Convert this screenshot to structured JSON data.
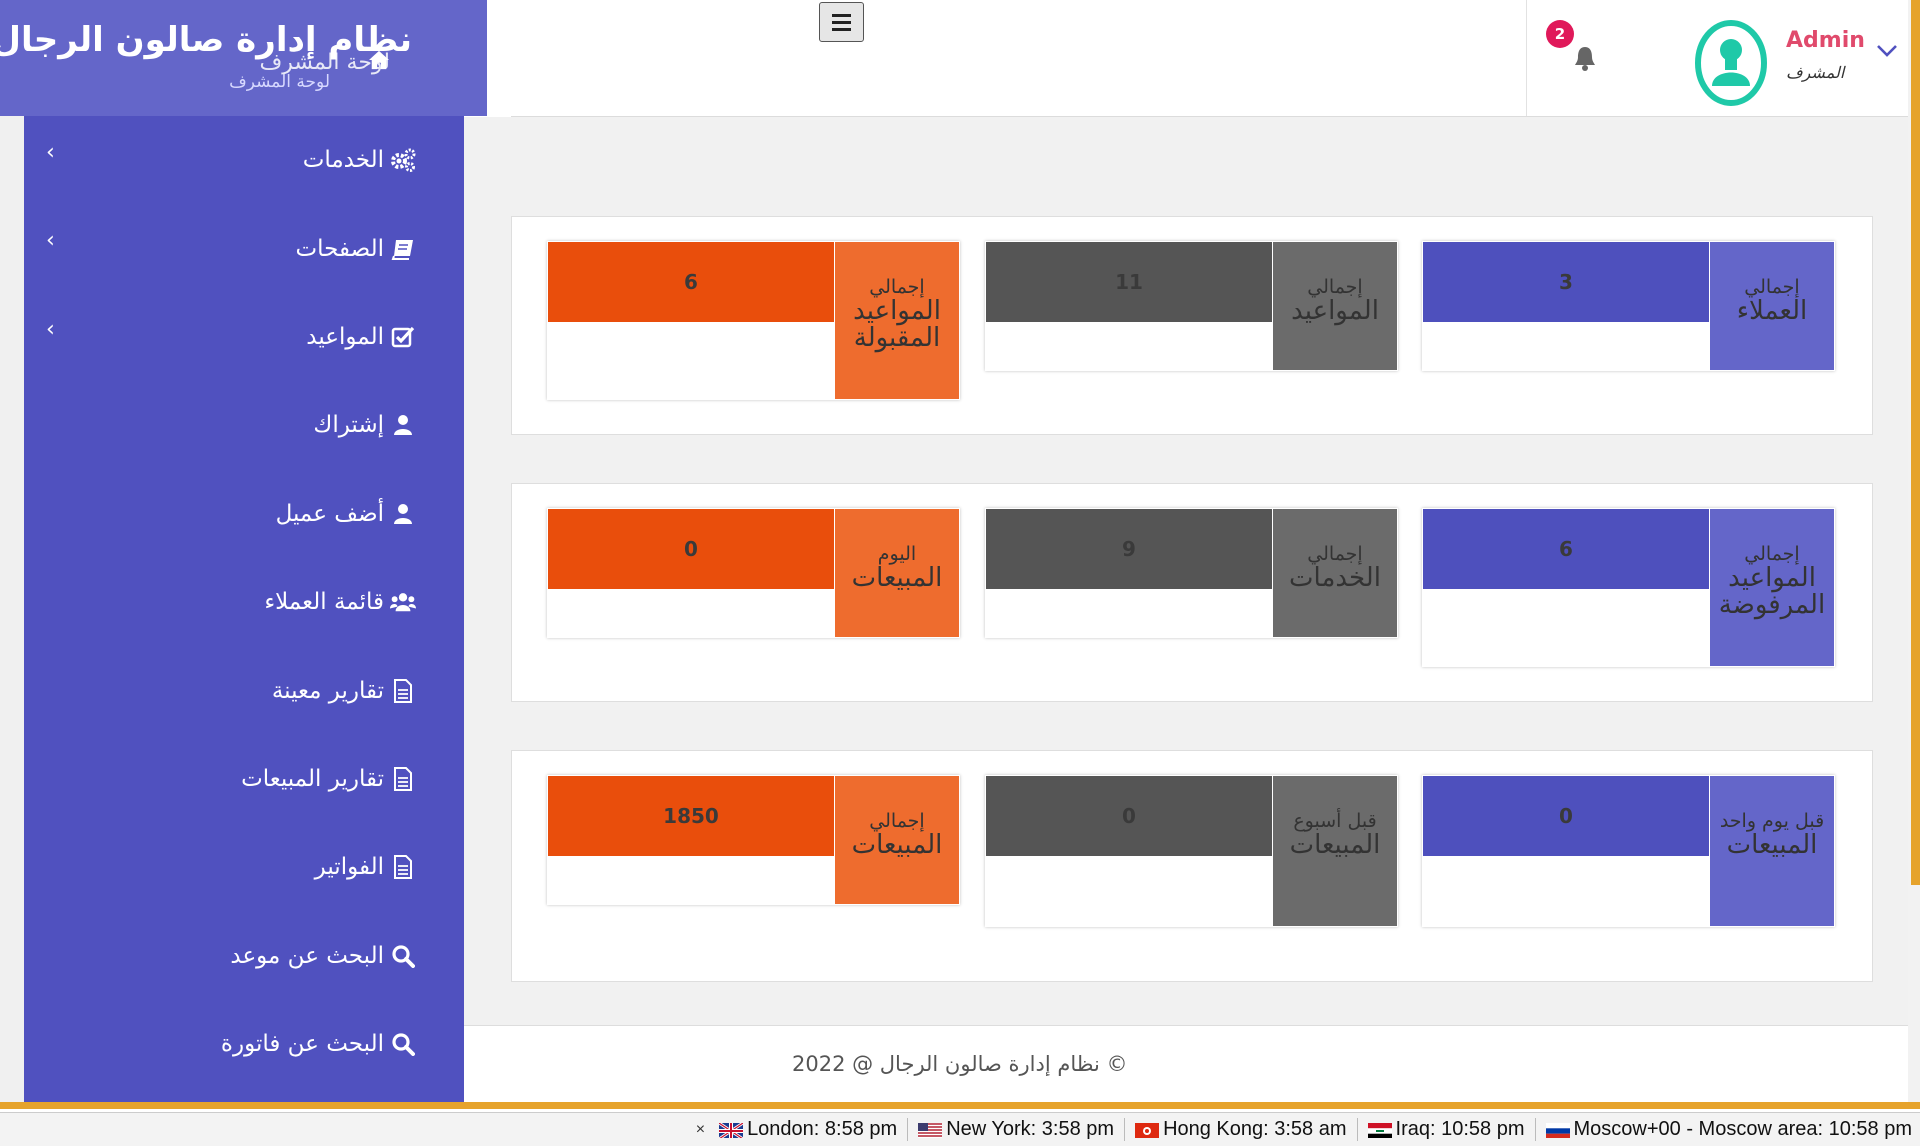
{
  "brand": {
    "title": "نظام إدارة صالون الرجال",
    "dashboard_ghost": "لوحة المشرف",
    "subtitle": "لوحة المشرف"
  },
  "sidebar": {
    "items": [
      {
        "label": "الخدمات",
        "icon": "cogs-icon",
        "has_submenu": true
      },
      {
        "label": "الصفحات",
        "icon": "book-icon",
        "has_submenu": true
      },
      {
        "label": "المواعيد",
        "icon": "check-square-icon",
        "has_submenu": true
      },
      {
        "label": "إشتراك",
        "icon": "user-icon",
        "has_submenu": false
      },
      {
        "label": "أضف عميل",
        "icon": "user-icon",
        "has_submenu": false
      },
      {
        "label": "قائمة العملاء",
        "icon": "users-icon",
        "has_submenu": false
      },
      {
        "label": "تقارير معينة",
        "icon": "file-icon",
        "has_submenu": false
      },
      {
        "label": "تقارير المبيعات",
        "icon": "file-icon",
        "has_submenu": false
      },
      {
        "label": "الفواتير",
        "icon": "file-icon",
        "has_submenu": false
      },
      {
        "label": "البحث عن موعد",
        "icon": "search-icon",
        "has_submenu": false
      },
      {
        "label": "البحث عن فاتورة",
        "icon": "search-icon",
        "has_submenu": false
      }
    ]
  },
  "header": {
    "notification_count": "2",
    "user_name": "Admin",
    "user_role": "المشرف"
  },
  "stats": {
    "row1": [
      {
        "small": "إجمالي",
        "big": "العملاء",
        "value": "3",
        "color": "blue"
      },
      {
        "small": "إجمالي",
        "big": "المواعيد",
        "value": "11",
        "color": "grey"
      },
      {
        "small": "إجمالي",
        "big": "المواعيد المقبولة",
        "value": "6",
        "color": "orange"
      }
    ],
    "row2": [
      {
        "small": "إجمالي",
        "big": "المواعيد المرفوضة",
        "value": "6",
        "color": "blue"
      },
      {
        "small": "إجمالي",
        "big": "الخدمات",
        "value": "9",
        "color": "grey"
      },
      {
        "small": "اليوم",
        "big": "المبيعات",
        "value": "0",
        "color": "orange"
      }
    ],
    "row3": [
      {
        "small": "قبل يوم واحد",
        "big": "المبيعات",
        "value": "0",
        "color": "blue"
      },
      {
        "small": "قبل أسبوع",
        "big": "المبيعات",
        "value": "0",
        "color": "grey"
      },
      {
        "small": "إجمالي",
        "big": "المبيعات",
        "value": "1850",
        "color": "orange"
      }
    ]
  },
  "footer": {
    "copyright": "© نظام إدارة صالون الرجال @ 2022"
  },
  "clockbar": {
    "close": "×",
    "clocks": [
      {
        "label": "London: 8:58 pm",
        "flag": "uk-flag"
      },
      {
        "label": "New York: 3:58 pm",
        "flag": "us-flag"
      },
      {
        "label": "Hong Kong: 3:58 am",
        "flag": "hk-flag"
      },
      {
        "label": "Iraq: 10:58 pm",
        "flag": "iraq-flag"
      },
      {
        "label": "Moscow+00 - Moscow area: 10:58 pm",
        "flag": "russia-flag"
      }
    ]
  },
  "colors": {
    "sidebar": "#5051bf",
    "brand": "#6466c9",
    "accent_orange": "#e94e0c",
    "badge": "#e0195a",
    "avatar": "#1fc9a8",
    "scroll_thumb": "#e6a32c"
  }
}
